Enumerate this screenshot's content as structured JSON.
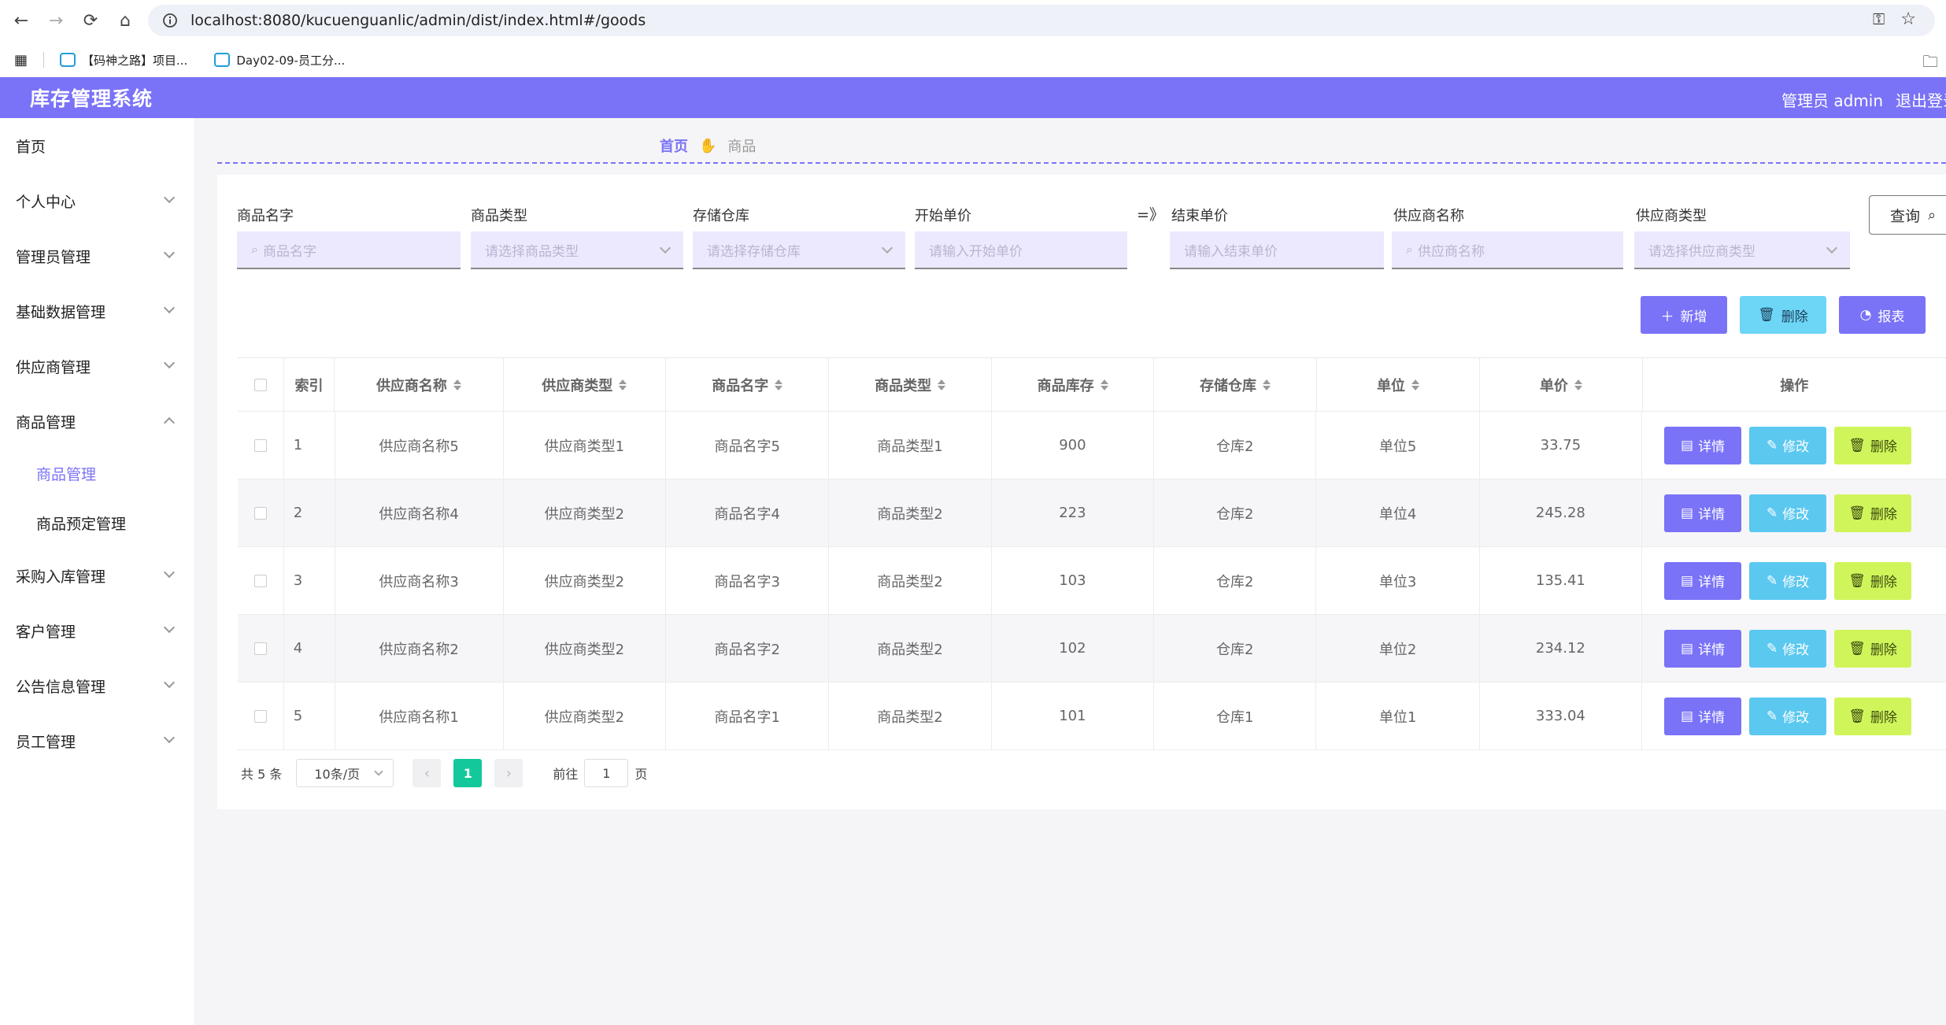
{
  "browser": {
    "url": "localhost:8080/kucuenguanlic/admin/dist/index.html#/goods",
    "bookmarks": [
      "【码神之路】项目...",
      "Day02-09-员工分..."
    ]
  },
  "header": {
    "title": "库存管理系统",
    "user": "管理员 admin",
    "logout": "退出登录"
  },
  "sidebar": {
    "items": [
      {
        "label": "首页"
      },
      {
        "label": "个人中心"
      },
      {
        "label": "管理员管理"
      },
      {
        "label": "基础数据管理"
      },
      {
        "label": "供应商管理"
      },
      {
        "label": "商品管理"
      },
      {
        "label": "采购入库管理"
      },
      {
        "label": "客户管理"
      },
      {
        "label": "公告信息管理"
      },
      {
        "label": "员工管理"
      }
    ],
    "sub_items": [
      {
        "label": "商品管理"
      },
      {
        "label": "商品预定管理"
      }
    ]
  },
  "breadcrumb": {
    "home": "首页",
    "current": "商品"
  },
  "filters": {
    "goods_name": {
      "label": "商品名字",
      "placeholder": "商品名字"
    },
    "goods_type": {
      "label": "商品类型",
      "placeholder": "请选择商品类型"
    },
    "warehouse": {
      "label": "存储仓库",
      "placeholder": "请选择存储仓库"
    },
    "start_price": {
      "label": "开始单价",
      "placeholder": "请输入开始单价"
    },
    "range_sep": "=》",
    "end_price": {
      "label": "结束单价",
      "placeholder": "请输入结束单价"
    },
    "supplier_name": {
      "label": "供应商名称",
      "placeholder": "供应商名称"
    },
    "supplier_type": {
      "label": "供应商类型",
      "placeholder": "请选择供应商类型"
    },
    "query_label": "查询"
  },
  "actions": {
    "add": "新增",
    "delete": "删除",
    "report": "报表"
  },
  "table": {
    "columns": [
      "索引",
      "供应商名称",
      "供应商类型",
      "商品名字",
      "商品类型",
      "商品库存",
      "存储仓库",
      "单位",
      "单价",
      "操作"
    ],
    "rows": [
      {
        "index": "1",
        "supplier": "供应商名称5",
        "supplier_type": "供应商类型1",
        "name": "商品名字5",
        "type": "商品类型1",
        "stock": "900",
        "warehouse": "仓库2",
        "unit": "单位5",
        "price": "33.75"
      },
      {
        "index": "2",
        "supplier": "供应商名称4",
        "supplier_type": "供应商类型2",
        "name": "商品名字4",
        "type": "商品类型2",
        "stock": "223",
        "warehouse": "仓库2",
        "unit": "单位4",
        "price": "245.28"
      },
      {
        "index": "3",
        "supplier": "供应商名称3",
        "supplier_type": "供应商类型2",
        "name": "商品名字3",
        "type": "商品类型2",
        "stock": "103",
        "warehouse": "仓库2",
        "unit": "单位3",
        "price": "135.41"
      },
      {
        "index": "4",
        "supplier": "供应商名称2",
        "supplier_type": "供应商类型2",
        "name": "商品名字2",
        "type": "商品类型2",
        "stock": "102",
        "warehouse": "仓库2",
        "unit": "单位2",
        "price": "234.12"
      },
      {
        "index": "5",
        "supplier": "供应商名称1",
        "supplier_type": "供应商类型2",
        "name": "商品名字1",
        "type": "商品类型2",
        "stock": "101",
        "warehouse": "仓库1",
        "unit": "单位1",
        "price": "333.04"
      }
    ],
    "row_ops": {
      "detail": "详情",
      "edit": "修改",
      "delete": "删除"
    }
  },
  "pagination": {
    "total": "共 5 条",
    "page_size": "10条/页",
    "current": "1",
    "goto_prefix": "前往",
    "goto_value": "1",
    "goto_suffix": "页"
  },
  "colors": {
    "accent": "#7a73f7",
    "info": "#5bc8f0",
    "danger": "#d0f55a",
    "page": "#13c89a",
    "cyan_btn": "#6dd5f5"
  }
}
